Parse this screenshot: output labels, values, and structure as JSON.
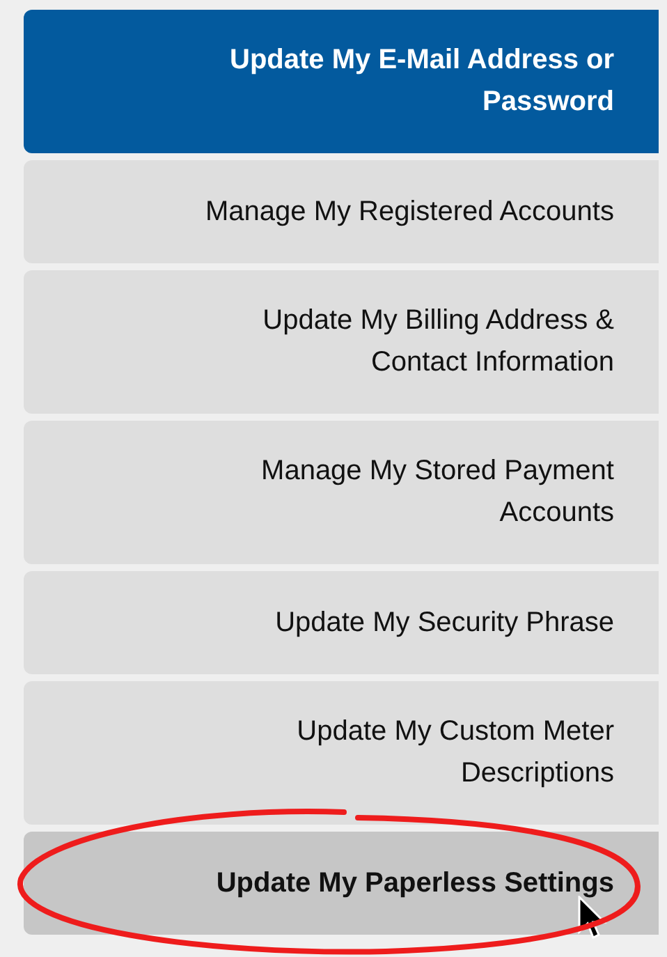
{
  "menu": {
    "items": [
      {
        "lines": [
          "Update My E-Mail Address or",
          "Password"
        ],
        "selected": true,
        "hovered": false
      },
      {
        "lines": [
          "Manage My Registered Accounts"
        ],
        "selected": false,
        "hovered": false
      },
      {
        "lines": [
          "Update My Billing Address &",
          "Contact Information"
        ],
        "selected": false,
        "hovered": false
      },
      {
        "lines": [
          "Manage My Stored Payment",
          "Accounts"
        ],
        "selected": false,
        "hovered": false
      },
      {
        "lines": [
          "Update My Security Phrase"
        ],
        "selected": false,
        "hovered": false
      },
      {
        "lines": [
          "Update My Custom Meter",
          "Descriptions"
        ],
        "selected": false,
        "hovered": false
      },
      {
        "lines": [
          "Update My Paperless Settings"
        ],
        "selected": false,
        "hovered": true,
        "circled": true
      }
    ]
  }
}
